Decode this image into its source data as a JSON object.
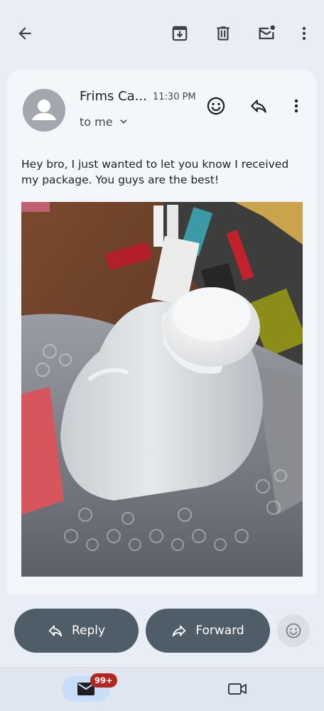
{
  "toolbar": {
    "back_icon": "arrow-back-icon",
    "archive_icon": "archive-icon",
    "delete_icon": "trash-icon",
    "mark_unread_icon": "mark-unread-icon",
    "more_icon": "more-vert-icon"
  },
  "email": {
    "sender": "Frims Ca...",
    "time": "11:30 PM",
    "recipient_label": "to me",
    "body": "Hey bro, I just wanted to let you know I received my package. You guys are the best!",
    "attachment_icon": "photo",
    "header_icons": [
      "emoji-reaction-icon",
      "reply-icon",
      "more-vert-icon"
    ]
  },
  "actions": {
    "reply_label": "Reply",
    "forward_label": "Forward",
    "react_icon": "emoji-icon"
  },
  "bottom_nav": {
    "mail_badge": "99+",
    "mail_icon": "mail-icon",
    "meet_icon": "video-camera-icon"
  },
  "colors": {
    "background": "#e9eef6",
    "card": "#f3f7fc",
    "pill": "#4e5d68",
    "badge": "#b3261e",
    "mail_tab": "#c8def8"
  }
}
